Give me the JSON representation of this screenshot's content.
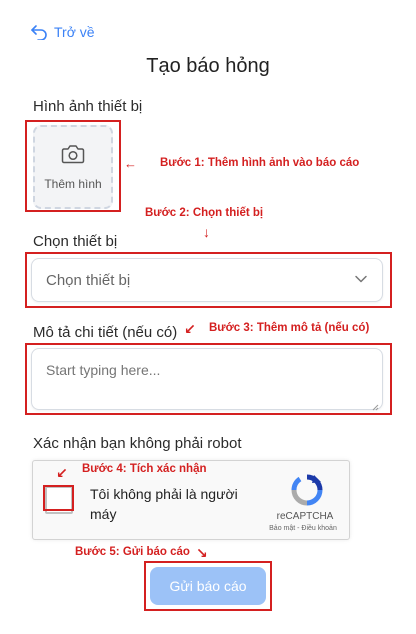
{
  "nav": {
    "back_label": "Trở về"
  },
  "page": {
    "title": "Tạo báo hỏng"
  },
  "image_section": {
    "label": "Hình ảnh thiết bị",
    "upload_label": "Thêm hình"
  },
  "device_section": {
    "label": "Chọn thiết bị",
    "select_value": "Chọn thiết bị"
  },
  "description_section": {
    "label": "Mô tả chi tiết (nếu có)",
    "placeholder": "Start typing here..."
  },
  "captcha_section": {
    "label": "Xác nhận bạn không phải robot",
    "checkbox_text": "Tôi không phải là người máy",
    "brand": "reCAPTCHA",
    "terms": "Bảo mật - Điều khoản"
  },
  "submit": {
    "label": "Gửi báo cáo"
  },
  "annotations": {
    "step1": "Bước 1: Thêm hình ảnh vào báo cáo",
    "step2": "Bước 2: Chọn thiết bị",
    "step3": "Bước 3: Thêm mô tả (nếu có)",
    "step4": "Bước 4: Tích xác nhận",
    "step5": "Bước 5: Gửi báo cáo"
  },
  "colors": {
    "accent": "#3b82f6",
    "annotation": "#d42020",
    "submit_disabled": "#9cc2f7"
  }
}
